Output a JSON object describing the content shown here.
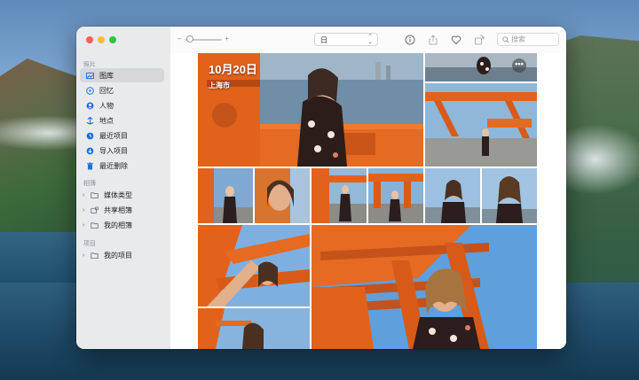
{
  "sidebar": {
    "sections": {
      "photos": "照片",
      "albums": "相簿",
      "projects": "项目"
    },
    "photos_items": [
      {
        "label": "图库",
        "icon": "library-icon",
        "selected": true
      },
      {
        "label": "回忆",
        "icon": "memories-icon"
      },
      {
        "label": "人物",
        "icon": "people-icon"
      },
      {
        "label": "地点",
        "icon": "places-icon"
      },
      {
        "label": "最近项目",
        "icon": "recents-icon"
      },
      {
        "label": "导入项目",
        "icon": "imports-icon"
      },
      {
        "label": "最近删除",
        "icon": "trash-icon"
      }
    ],
    "album_items": [
      {
        "label": "媒体类型",
        "icon": "folder-icon"
      },
      {
        "label": "共享相簿",
        "icon": "shared-album-icon"
      },
      {
        "label": "我的相簿",
        "icon": "folder-icon"
      }
    ],
    "project_items": [
      {
        "label": "我的项目",
        "icon": "folder-icon"
      }
    ]
  },
  "toolbar": {
    "zoom_minus": "–",
    "zoom_plus": "+",
    "view_value": "日",
    "search_placeholder": "搜索"
  },
  "content": {
    "date": "10月20日",
    "location": "上海市",
    "more": "•••"
  },
  "colors": {
    "accent": "#1d6fe0",
    "orange": "#e4631f",
    "sky": "#6aa6dd"
  }
}
